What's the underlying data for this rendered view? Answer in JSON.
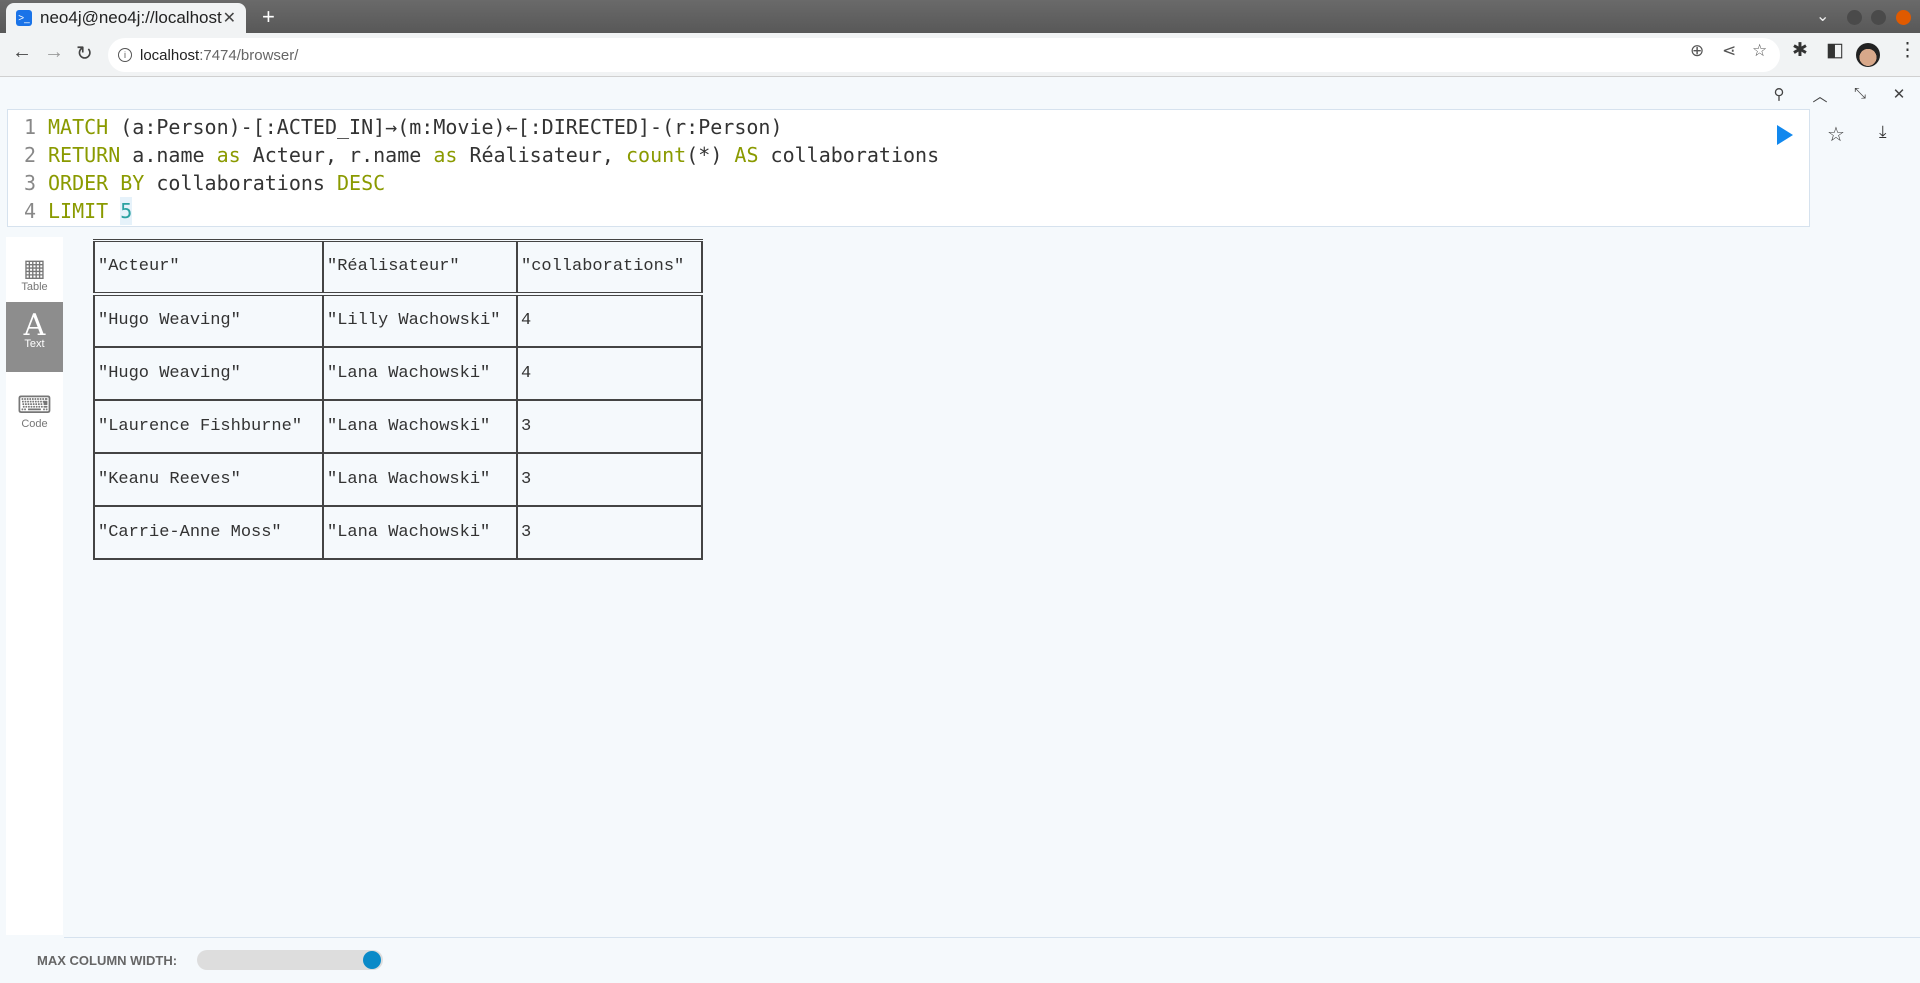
{
  "browser": {
    "tab_title": "neo4j@neo4j://localhost",
    "url_host": "localhost",
    "url_rest": ":7474/browser/"
  },
  "frame_icons": [
    "pin-icon",
    "collapse-icon",
    "shrink-icon",
    "close-icon"
  ],
  "editor": {
    "lines": [
      {
        "n": "1",
        "parts": [
          [
            "kw",
            "MATCH "
          ],
          [
            "tx",
            "(a:Person)-[:ACTED_IN]→(m:Movie)←[:DIRECTED]-(r:Person)"
          ]
        ]
      },
      {
        "n": "2",
        "parts": [
          [
            "kw",
            "RETURN "
          ],
          [
            "tx",
            "a.name "
          ],
          [
            "kw",
            "as "
          ],
          [
            "tx",
            "Acteur, r.name "
          ],
          [
            "kw",
            "as "
          ],
          [
            "tx",
            "Réalisateur, "
          ],
          [
            "kw",
            "count"
          ],
          [
            "tx",
            "(*) "
          ],
          [
            "kw",
            "AS "
          ],
          [
            "tx",
            "collaborations"
          ]
        ]
      },
      {
        "n": "3",
        "parts": [
          [
            "kw",
            "ORDER BY "
          ],
          [
            "tx",
            "collaborations "
          ],
          [
            "kw",
            "DESC"
          ]
        ]
      },
      {
        "n": "4",
        "parts": [
          [
            "kw",
            "LIMIT "
          ],
          [
            "num",
            "5"
          ]
        ]
      }
    ]
  },
  "sidebar": {
    "items": [
      {
        "label": "Table",
        "icon": "table-icon"
      },
      {
        "label": "Text",
        "icon": "text-icon",
        "selected": true
      },
      {
        "label": "Code",
        "icon": "code-icon"
      }
    ]
  },
  "result": {
    "headers": [
      "\"Acteur\"",
      "\"Réalisateur\"",
      "\"collaborations\""
    ],
    "rows": [
      [
        "\"Hugo Weaving\"",
        "\"Lilly Wachowski\"",
        "4"
      ],
      [
        "\"Hugo Weaving\"",
        "\"Lana Wachowski\"",
        "4"
      ],
      [
        "\"Laurence Fishburne\"",
        "\"Lana Wachowski\"",
        "3"
      ],
      [
        "\"Keanu Reeves\"",
        "\"Lana Wachowski\"",
        "3"
      ],
      [
        "\"Carrie-Anne Moss\"",
        "\"Lana Wachowski\"",
        "3"
      ]
    ]
  },
  "footer": {
    "label": "MAX COLUMN WIDTH:",
    "slider_value_pct": 100
  },
  "colors": {
    "accent": "#1188ee",
    "slider": "#0a8ac8",
    "keyword": "#8a9a00"
  }
}
